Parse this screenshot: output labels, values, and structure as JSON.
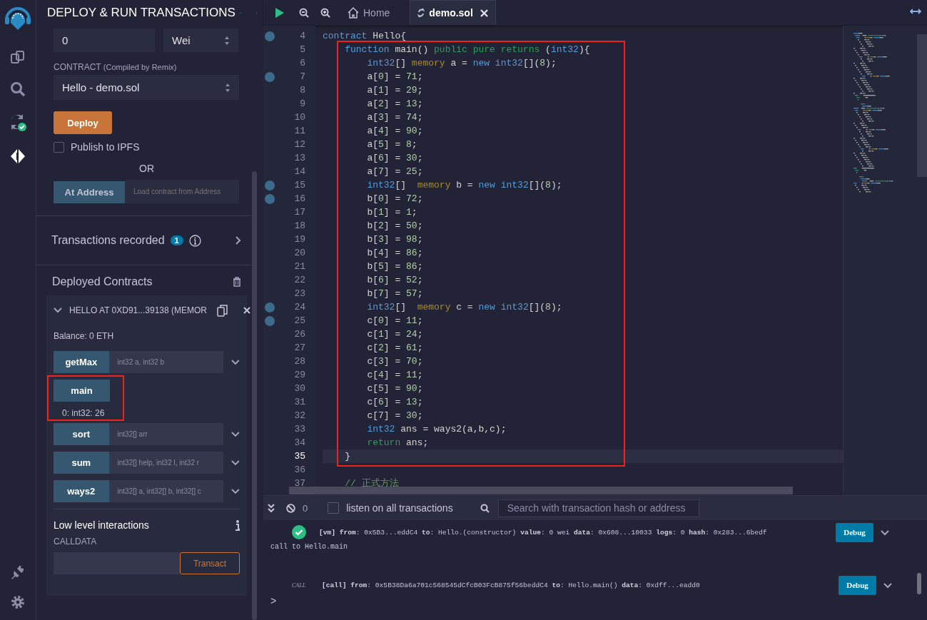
{
  "icon_bar": {
    "top": [
      {
        "kind": "files",
        "selected": false
      },
      {
        "kind": "search",
        "selected": false
      },
      {
        "kind": "compiler",
        "selected": false
      },
      {
        "kind": "deploy",
        "selected": true
      }
    ],
    "bottom": [
      {
        "kind": "plugin",
        "selected": false
      },
      {
        "kind": "settings",
        "selected": false
      }
    ]
  },
  "panel": {
    "title": "DEPLOY & RUN TRANSACTIONS",
    "value": {
      "value": "0",
      "unit": "Wei"
    },
    "contract_label": "CONTRACT",
    "contract_hint": "(Compiled by Remix)",
    "contract": "Hello - demo.sol",
    "deploy_button": "Deploy",
    "publish": {
      "label": "Publish to IPFS",
      "checked": false
    },
    "or": "OR",
    "at_address": {
      "button": "At Address",
      "placeholder": "Load contract from Address"
    },
    "transactions": {
      "label": "Transactions recorded",
      "count": "1"
    },
    "deployed_title": "Deployed Contracts",
    "instance": {
      "title": "HELLO AT 0XD91...39138 (MEMOR",
      "balance": "Balance: 0 ETH",
      "functions": [
        {
          "name": "getMax",
          "kind": "input",
          "placeholder": "int32 a, int32 b",
          "highlighted": false
        },
        {
          "name": "main",
          "kind": "call",
          "result": "0: int32: 26",
          "highlighted": true
        },
        {
          "name": "sort",
          "kind": "input",
          "placeholder": "int32[] arr",
          "highlighted": false
        },
        {
          "name": "sum",
          "kind": "input",
          "placeholder": "int32[] help, int32 l, int32 r",
          "highlighted": false
        },
        {
          "name": "ways2",
          "kind": "input",
          "placeholder": "int32[] a, int32[] b, int32[] c",
          "highlighted": false
        }
      ],
      "low_level": {
        "title": "Low level interactions",
        "calldata": "CALLDATA",
        "button": "Transact"
      }
    }
  },
  "tabs": [
    {
      "kind": "home",
      "label": "Home",
      "selected": false
    },
    {
      "kind": "file",
      "label": "demo.sol",
      "selected": true
    }
  ],
  "editor": {
    "lines": [
      {
        "kind": "line",
        "n": "4",
        "breakpoint": true,
        "active": false,
        "tokens": [
          {
            "kind": "kw",
            "text": "contract"
          },
          {
            "kind": "p",
            "text": " Hello{"
          }
        ]
      },
      {
        "kind": "highlight",
        "lines": [
          {
            "kind": "line",
            "n": "5",
            "breakpoint": false,
            "active": false,
            "tokens": [
              {
                "kind": "kw",
                "text": "    function"
              },
              {
                "kind": "p",
                "text": " main() "
              },
              {
                "kind": "mod",
                "text": "public pure returns"
              },
              {
                "kind": "p",
                "text": " ("
              },
              {
                "kind": "kw",
                "text": "int32"
              },
              {
                "kind": "p",
                "text": "){"
              }
            ]
          },
          {
            "kind": "line",
            "n": "6",
            "breakpoint": false,
            "active": false,
            "tokens": [
              {
                "kind": "kw",
                "text": "        int32"
              },
              {
                "kind": "p",
                "text": "[] "
              },
              {
                "kind": "mem",
                "text": "memory"
              },
              {
                "kind": "p",
                "text": " a = "
              },
              {
                "kind": "kw",
                "text": "new int32"
              },
              {
                "kind": "p",
                "text": "[]("
              },
              {
                "kind": "num",
                "text": "8"
              },
              {
                "kind": "p",
                "text": ");"
              }
            ]
          },
          {
            "kind": "line",
            "n": "7",
            "breakpoint": true,
            "active": false,
            "tokens": [
              {
                "kind": "p",
                "text": "        a["
              },
              {
                "kind": "num",
                "text": "0"
              },
              {
                "kind": "p",
                "text": "] = "
              },
              {
                "kind": "num",
                "text": "71"
              },
              {
                "kind": "p",
                "text": ";"
              }
            ]
          },
          {
            "kind": "line",
            "n": "8",
            "breakpoint": false,
            "active": false,
            "tokens": [
              {
                "kind": "p",
                "text": "        a["
              },
              {
                "kind": "num",
                "text": "1"
              },
              {
                "kind": "p",
                "text": "] = "
              },
              {
                "kind": "num",
                "text": "29"
              },
              {
                "kind": "p",
                "text": ";"
              }
            ]
          },
          {
            "kind": "line",
            "n": "9",
            "breakpoint": false,
            "active": false,
            "tokens": [
              {
                "kind": "p",
                "text": "        a["
              },
              {
                "kind": "num",
                "text": "2"
              },
              {
                "kind": "p",
                "text": "] = "
              },
              {
                "kind": "num",
                "text": "13"
              },
              {
                "kind": "p",
                "text": ";"
              }
            ]
          },
          {
            "kind": "line",
            "n": "10",
            "breakpoint": false,
            "active": false,
            "tokens": [
              {
                "kind": "p",
                "text": "        a["
              },
              {
                "kind": "num",
                "text": "3"
              },
              {
                "kind": "p",
                "text": "] = "
              },
              {
                "kind": "num",
                "text": "74"
              },
              {
                "kind": "p",
                "text": ";"
              }
            ]
          },
          {
            "kind": "line",
            "n": "11",
            "breakpoint": false,
            "active": false,
            "tokens": [
              {
                "kind": "p",
                "text": "        a["
              },
              {
                "kind": "num",
                "text": "4"
              },
              {
                "kind": "p",
                "text": "] = "
              },
              {
                "kind": "num",
                "text": "90"
              },
              {
                "kind": "p",
                "text": ";"
              }
            ]
          },
          {
            "kind": "line",
            "n": "12",
            "breakpoint": false,
            "active": false,
            "tokens": [
              {
                "kind": "p",
                "text": "        a["
              },
              {
                "kind": "num",
                "text": "5"
              },
              {
                "kind": "p",
                "text": "] = "
              },
              {
                "kind": "num",
                "text": "8"
              },
              {
                "kind": "p",
                "text": ";"
              }
            ]
          },
          {
            "kind": "line",
            "n": "13",
            "breakpoint": false,
            "active": false,
            "tokens": [
              {
                "kind": "p",
                "text": "        a["
              },
              {
                "kind": "num",
                "text": "6"
              },
              {
                "kind": "p",
                "text": "] = "
              },
              {
                "kind": "num",
                "text": "30"
              },
              {
                "kind": "p",
                "text": ";"
              }
            ]
          },
          {
            "kind": "line",
            "n": "14",
            "breakpoint": false,
            "active": false,
            "tokens": [
              {
                "kind": "p",
                "text": "        a["
              },
              {
                "kind": "num",
                "text": "7"
              },
              {
                "kind": "p",
                "text": "] = "
              },
              {
                "kind": "num",
                "text": "25"
              },
              {
                "kind": "p",
                "text": ";"
              }
            ]
          },
          {
            "kind": "line",
            "n": "15",
            "breakpoint": true,
            "active": false,
            "tokens": [
              {
                "kind": "kw",
                "text": "        int32"
              },
              {
                "kind": "p",
                "text": "[]  "
              },
              {
                "kind": "mem",
                "text": "memory"
              },
              {
                "kind": "p",
                "text": " b = "
              },
              {
                "kind": "kw",
                "text": "new int32"
              },
              {
                "kind": "p",
                "text": "[]("
              },
              {
                "kind": "num",
                "text": "8"
              },
              {
                "kind": "p",
                "text": ");"
              }
            ]
          },
          {
            "kind": "line",
            "n": "16",
            "breakpoint": true,
            "active": false,
            "tokens": [
              {
                "kind": "p",
                "text": "        b["
              },
              {
                "kind": "num",
                "text": "0"
              },
              {
                "kind": "p",
                "text": "] = "
              },
              {
                "kind": "num",
                "text": "72"
              },
              {
                "kind": "p",
                "text": ";"
              }
            ]
          },
          {
            "kind": "line",
            "n": "17",
            "breakpoint": false,
            "active": false,
            "tokens": [
              {
                "kind": "p",
                "text": "        b["
              },
              {
                "kind": "num",
                "text": "1"
              },
              {
                "kind": "p",
                "text": "] = "
              },
              {
                "kind": "num",
                "text": "1"
              },
              {
                "kind": "p",
                "text": ";"
              }
            ]
          },
          {
            "kind": "line",
            "n": "18",
            "breakpoint": false,
            "active": false,
            "tokens": [
              {
                "kind": "p",
                "text": "        b["
              },
              {
                "kind": "num",
                "text": "2"
              },
              {
                "kind": "p",
                "text": "] = "
              },
              {
                "kind": "num",
                "text": "50"
              },
              {
                "kind": "p",
                "text": ";"
              }
            ]
          },
          {
            "kind": "line",
            "n": "19",
            "breakpoint": false,
            "active": false,
            "tokens": [
              {
                "kind": "p",
                "text": "        b["
              },
              {
                "kind": "num",
                "text": "3"
              },
              {
                "kind": "p",
                "text": "] = "
              },
              {
                "kind": "num",
                "text": "98"
              },
              {
                "kind": "p",
                "text": ";"
              }
            ]
          },
          {
            "kind": "line",
            "n": "20",
            "breakpoint": false,
            "active": false,
            "tokens": [
              {
                "kind": "p",
                "text": "        b["
              },
              {
                "kind": "num",
                "text": "4"
              },
              {
                "kind": "p",
                "text": "] = "
              },
              {
                "kind": "num",
                "text": "86"
              },
              {
                "kind": "p",
                "text": ";"
              }
            ]
          },
          {
            "kind": "line",
            "n": "21",
            "breakpoint": false,
            "active": false,
            "tokens": [
              {
                "kind": "p",
                "text": "        b["
              },
              {
                "kind": "num",
                "text": "5"
              },
              {
                "kind": "p",
                "text": "] = "
              },
              {
                "kind": "num",
                "text": "86"
              },
              {
                "kind": "p",
                "text": ";"
              }
            ]
          },
          {
            "kind": "line",
            "n": "22",
            "breakpoint": false,
            "active": false,
            "tokens": [
              {
                "kind": "p",
                "text": "        b["
              },
              {
                "kind": "num",
                "text": "6"
              },
              {
                "kind": "p",
                "text": "] = "
              },
              {
                "kind": "num",
                "text": "52"
              },
              {
                "kind": "p",
                "text": ";"
              }
            ]
          },
          {
            "kind": "line",
            "n": "23",
            "breakpoint": false,
            "active": false,
            "tokens": [
              {
                "kind": "p",
                "text": "        b["
              },
              {
                "kind": "num",
                "text": "7"
              },
              {
                "kind": "p",
                "text": "] = "
              },
              {
                "kind": "num",
                "text": "57"
              },
              {
                "kind": "p",
                "text": ";"
              }
            ]
          },
          {
            "kind": "line",
            "n": "24",
            "breakpoint": true,
            "active": false,
            "tokens": [
              {
                "kind": "kw",
                "text": "        int32"
              },
              {
                "kind": "p",
                "text": "[]  "
              },
              {
                "kind": "mem",
                "text": "memory"
              },
              {
                "kind": "p",
                "text": " c = "
              },
              {
                "kind": "kw",
                "text": "new int32"
              },
              {
                "kind": "p",
                "text": "[]("
              },
              {
                "kind": "num",
                "text": "8"
              },
              {
                "kind": "p",
                "text": ");"
              }
            ]
          },
          {
            "kind": "line",
            "n": "25",
            "breakpoint": true,
            "active": false,
            "tokens": [
              {
                "kind": "p",
                "text": "        c["
              },
              {
                "kind": "num",
                "text": "0"
              },
              {
                "kind": "p",
                "text": "] = "
              },
              {
                "kind": "num",
                "text": "11"
              },
              {
                "kind": "p",
                "text": ";"
              }
            ]
          },
          {
            "kind": "line",
            "n": "26",
            "breakpoint": false,
            "active": false,
            "tokens": [
              {
                "kind": "p",
                "text": "        c["
              },
              {
                "kind": "num",
                "text": "1"
              },
              {
                "kind": "p",
                "text": "] = "
              },
              {
                "kind": "num",
                "text": "24"
              },
              {
                "kind": "p",
                "text": ";"
              }
            ]
          },
          {
            "kind": "line",
            "n": "27",
            "breakpoint": false,
            "active": false,
            "tokens": [
              {
                "kind": "p",
                "text": "        c["
              },
              {
                "kind": "num",
                "text": "2"
              },
              {
                "kind": "p",
                "text": "] = "
              },
              {
                "kind": "num",
                "text": "61"
              },
              {
                "kind": "p",
                "text": ";"
              }
            ]
          },
          {
            "kind": "line",
            "n": "28",
            "breakpoint": false,
            "active": false,
            "tokens": [
              {
                "kind": "p",
                "text": "        c["
              },
              {
                "kind": "num",
                "text": "3"
              },
              {
                "kind": "p",
                "text": "] = "
              },
              {
                "kind": "num",
                "text": "70"
              },
              {
                "kind": "p",
                "text": ";"
              }
            ]
          },
          {
            "kind": "line",
            "n": "29",
            "breakpoint": false,
            "active": false,
            "tokens": [
              {
                "kind": "p",
                "text": "        c["
              },
              {
                "kind": "num",
                "text": "4"
              },
              {
                "kind": "p",
                "text": "] = "
              },
              {
                "kind": "num",
                "text": "11"
              },
              {
                "kind": "p",
                "text": ";"
              }
            ]
          },
          {
            "kind": "line",
            "n": "30",
            "breakpoint": false,
            "active": false,
            "tokens": [
              {
                "kind": "p",
                "text": "        c["
              },
              {
                "kind": "num",
                "text": "5"
              },
              {
                "kind": "p",
                "text": "] = "
              },
              {
                "kind": "num",
                "text": "90"
              },
              {
                "kind": "p",
                "text": ";"
              }
            ]
          },
          {
            "kind": "line",
            "n": "31",
            "breakpoint": false,
            "active": false,
            "tokens": [
              {
                "kind": "p",
                "text": "        c["
              },
              {
                "kind": "num",
                "text": "6"
              },
              {
                "kind": "p",
                "text": "] = "
              },
              {
                "kind": "num",
                "text": "13"
              },
              {
                "kind": "p",
                "text": ";"
              }
            ]
          },
          {
            "kind": "line",
            "n": "32",
            "breakpoint": false,
            "active": false,
            "tokens": [
              {
                "kind": "p",
                "text": "        c["
              },
              {
                "kind": "num",
                "text": "7"
              },
              {
                "kind": "p",
                "text": "] = "
              },
              {
                "kind": "num",
                "text": "30"
              },
              {
                "kind": "p",
                "text": ";"
              }
            ]
          },
          {
            "kind": "line",
            "n": "33",
            "breakpoint": false,
            "active": false,
            "tokens": [
              {
                "kind": "kw",
                "text": "        int32"
              },
              {
                "kind": "p",
                "text": " ans = ways2(a,b,c);"
              }
            ]
          },
          {
            "kind": "line",
            "n": "34",
            "breakpoint": false,
            "active": false,
            "tokens": [
              {
                "kind": "mod",
                "text": "        return"
              },
              {
                "kind": "p",
                "text": " ans;"
              }
            ]
          },
          {
            "kind": "line",
            "n": "35",
            "breakpoint": false,
            "active": true,
            "tokens": [
              {
                "kind": "p",
                "text": "    }"
              }
            ]
          }
        ]
      },
      {
        "kind": "line",
        "n": "36",
        "breakpoint": false,
        "active": false
      },
      {
        "kind": "line",
        "n": "37",
        "breakpoint": false,
        "active": false,
        "tokens": [
          {
            "kind": "cmt",
            "text": "    // 正式方法"
          }
        ]
      }
    ]
  },
  "terminal": {
    "count": "0",
    "listen": {
      "label": "listen on all transactions",
      "checked": false
    },
    "search_placeholder": "Search with transaction hash or address",
    "logs": [
      {
        "kind": "success",
        "text": "**[vm]** **from**: 0x5B3...eddC4 **to**: Hello.(constructor) **value**: 0 wei **data**: 0x608...10033 **logs**: 0 **hash**: 0x283...6bedf",
        "button": "Debug"
      },
      {
        "kind": "message",
        "text": "call to Hello.main"
      },
      {
        "kind": "call",
        "tag": "CALL",
        "text": "**[call]** **from**: 0x5B38Da6a701c568545dCfcB03FcB875f56beddC4 **to**: Hello.main() **data**: 0xdff...eadd0",
        "button": "Debug"
      }
    ],
    "prompt": ">"
  }
}
